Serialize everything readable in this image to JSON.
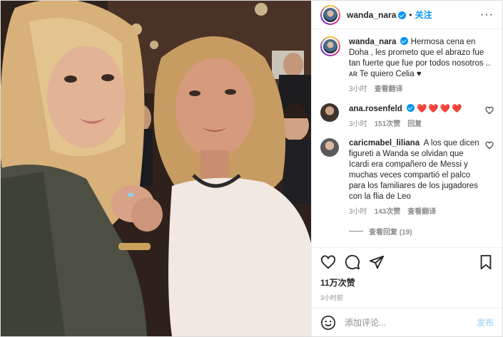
{
  "post": {
    "author": {
      "username": "wanda_nara",
      "verified": true,
      "follow_label": "关注",
      "more_label": "···"
    },
    "caption": {
      "username": "wanda_nara",
      "text": "Hermosa cena en Doha , les prometo que el abrazo fue tan fuerte que fue por todos nosotros .. ᴀʀ Te quiero Celia ♥",
      "time": "3小时",
      "translate_label": "查看翻译"
    },
    "comments": [
      {
        "username": "ana.rosenfeld",
        "verified": true,
        "text": "❤️❤️❤️❤️",
        "time": "3小时",
        "likes": "151次赞",
        "reply_label": "回复"
      },
      {
        "username": "caricmabel_liliana",
        "verified": false,
        "text": "A los que dicen figureti a Wanda se olvidan que Icardi era compañero de Messi y muchas veces compartió el palco para los familiares de los jugadores con la flia de Leo",
        "time": "3小时",
        "likes": "143次赞",
        "translate_label": "查看翻译",
        "view_replies": "查看回复 (19)"
      }
    ],
    "like_count": "11万次赞",
    "posted_time": "3小时前",
    "add_comment_placeholder": "添加评论...",
    "post_button": "发布",
    "icons": {
      "like": "heart-icon",
      "comment": "comment-icon",
      "share": "paper-plane-icon",
      "save": "bookmark-icon",
      "emoji": "smiley-icon",
      "more": "more-dots-icon"
    },
    "colors": {
      "accent": "#0095f6",
      "text": "#262626",
      "muted": "#8e8e8e",
      "heart": "#e0245e",
      "post_button_disabled": "#b2dffc"
    }
  }
}
